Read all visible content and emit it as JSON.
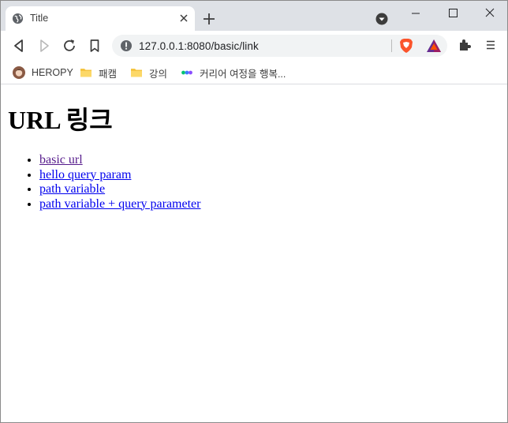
{
  "tab": {
    "title": "Title"
  },
  "omnibox": {
    "url": "127.0.0.1:8080/basic/link"
  },
  "bookmarks": [
    {
      "label": "HEROPY",
      "icon": "avatar-icon"
    },
    {
      "label": "패캠",
      "icon": "folder-icon"
    },
    {
      "label": "강의",
      "icon": "folder-icon"
    },
    {
      "label": "커리어 여정을 행복...",
      "icon": "dots-logo-icon"
    }
  ],
  "page": {
    "heading": "URL 링크",
    "links": [
      {
        "label": "basic url",
        "visited": true
      },
      {
        "label": "hello query param",
        "visited": false
      },
      {
        "label": "path variable",
        "visited": false
      },
      {
        "label": "path variable + query parameter",
        "visited": false
      }
    ]
  },
  "colors": {
    "link": "#0000ee",
    "visited_link": "#551a8b",
    "tab_strip": "#dee1e6",
    "omnibox_bg": "#f1f3f4",
    "brave_orange": "#fb542b"
  }
}
